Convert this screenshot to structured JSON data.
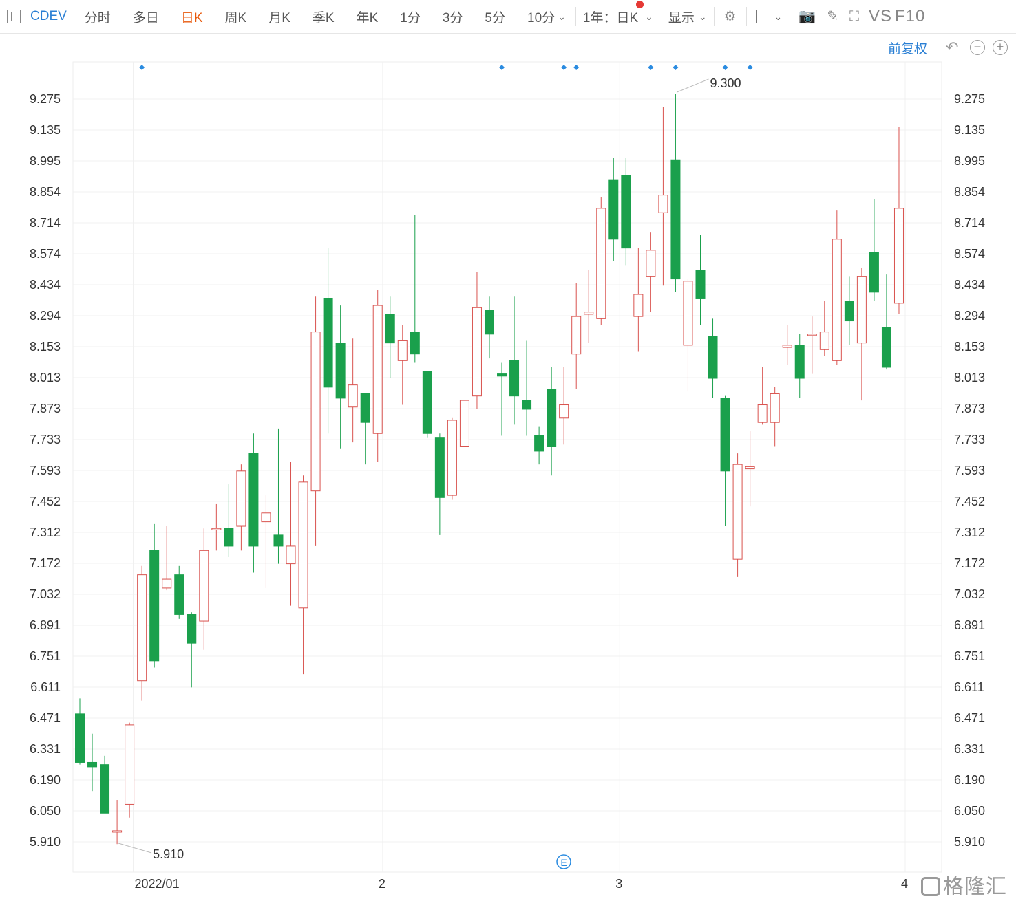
{
  "toolbar": {
    "symbol": "CDEV",
    "tabs": [
      "分时",
      "多日",
      "日K",
      "周K",
      "月K",
      "季K",
      "年K",
      "1分",
      "3分",
      "5分",
      "10分"
    ],
    "active_tab": "日K",
    "range_label": "1年：日K",
    "display_label": "显示",
    "vs_label": "VS",
    "f10_label": "F10",
    "icons": [
      "sidebar-toggle-icon",
      "chevron-down-icon",
      "gear-icon",
      "square-icon",
      "camera-icon",
      "pencil-icon",
      "fullscreen-icon",
      "panel-icon"
    ]
  },
  "subheader": {
    "adjust_label": "前复权",
    "controls": [
      "undo-icon",
      "zoom-out-icon",
      "zoom-in-icon"
    ]
  },
  "watermark": "格隆汇",
  "event_badge": "E",
  "chart_data": {
    "type": "candlestick",
    "title": "",
    "ylim": [
      5.91,
      9.275
    ],
    "y_ticks": [
      "9.275",
      "9.135",
      "8.995",
      "8.854",
      "8.714",
      "8.574",
      "8.434",
      "8.294",
      "8.153",
      "8.013",
      "7.873",
      "7.733",
      "7.593",
      "7.452",
      "7.312",
      "7.172",
      "7.032",
      "6.891",
      "6.751",
      "6.611",
      "6.471",
      "6.331",
      "6.190",
      "6.050",
      "5.910"
    ],
    "x_labels": [
      {
        "label": "2022/01",
        "index": 4.3
      },
      {
        "label": "2",
        "index": 24.4
      },
      {
        "label": "3",
        "index": 43.5
      },
      {
        "label": "4",
        "index": 66.5
      }
    ],
    "max_annotation": {
      "value": "9.300",
      "index": 48
    },
    "min_annotation": {
      "value": "5.910",
      "index": 3
    },
    "up_color": "#d9534f",
    "down_color": "#1aa04c",
    "marker_color": "#2a8be0",
    "event_markers": [
      5,
      34,
      39,
      40,
      46,
      48,
      52,
      54
    ],
    "candles": [
      [
        6.49,
        6.27,
        6.56,
        6.26
      ],
      [
        6.27,
        6.25,
        6.4,
        6.14
      ],
      [
        6.26,
        6.04,
        6.3,
        6.04
      ],
      [
        5.96,
        5.96,
        6.1,
        5.9
      ],
      [
        6.08,
        6.44,
        6.45,
        6.02
      ],
      [
        6.64,
        7.12,
        7.16,
        6.55
      ],
      [
        7.23,
        6.73,
        7.35,
        6.7
      ],
      [
        7.06,
        7.1,
        7.34,
        7.05
      ],
      [
        7.12,
        6.94,
        7.16,
        6.92
      ],
      [
        6.94,
        6.81,
        6.95,
        6.61
      ],
      [
        6.91,
        7.23,
        7.33,
        6.78
      ],
      [
        7.33,
        7.33,
        7.44,
        7.23
      ],
      [
        7.33,
        7.25,
        7.53,
        7.2
      ],
      [
        7.34,
        7.59,
        7.62,
        7.23
      ],
      [
        7.67,
        7.25,
        7.76,
        7.13
      ],
      [
        7.36,
        7.4,
        7.48,
        7.06
      ],
      [
        7.3,
        7.25,
        7.78,
        7.17
      ],
      [
        7.17,
        7.25,
        7.63,
        6.98
      ],
      [
        6.97,
        7.54,
        7.57,
        6.67
      ],
      [
        7.5,
        8.22,
        8.38,
        7.25
      ],
      [
        8.37,
        7.97,
        8.6,
        7.76
      ],
      [
        8.17,
        7.92,
        8.34,
        7.69
      ],
      [
        7.88,
        7.98,
        8.19,
        7.72
      ],
      [
        7.94,
        7.81,
        7.94,
        7.62
      ],
      [
        7.76,
        8.34,
        8.41,
        7.63
      ],
      [
        8.3,
        8.17,
        8.38,
        8.01
      ],
      [
        8.09,
        8.18,
        8.25,
        7.89
      ],
      [
        8.22,
        8.12,
        8.75,
        8.08
      ],
      [
        8.04,
        7.76,
        8.04,
        7.74
      ],
      [
        7.74,
        7.47,
        7.76,
        7.3
      ],
      [
        7.48,
        7.82,
        7.83,
        7.46
      ],
      [
        7.7,
        7.91,
        7.9,
        7.7
      ],
      [
        7.93,
        8.33,
        8.49,
        7.87
      ],
      [
        8.32,
        8.21,
        8.38,
        8.1
      ],
      [
        8.03,
        8.02,
        8.08,
        7.75
      ],
      [
        8.09,
        7.93,
        8.38,
        7.8
      ],
      [
        7.91,
        7.87,
        8.18,
        7.75
      ],
      [
        7.75,
        7.68,
        7.79,
        7.62
      ],
      [
        7.96,
        7.7,
        8.06,
        7.57
      ],
      [
        7.83,
        7.89,
        8.06,
        7.71
      ],
      [
        8.12,
        8.29,
        8.44,
        7.96
      ],
      [
        8.3,
        8.31,
        8.5,
        8.17
      ],
      [
        8.28,
        8.78,
        8.83,
        8.25
      ],
      [
        8.91,
        8.64,
        9.01,
        8.54
      ],
      [
        8.93,
        8.6,
        9.01,
        8.52
      ],
      [
        8.29,
        8.39,
        8.6,
        8.13
      ],
      [
        8.47,
        8.59,
        8.67,
        8.31
      ],
      [
        8.76,
        8.84,
        9.24,
        8.43
      ],
      [
        9.0,
        8.46,
        9.3,
        8.4
      ],
      [
        8.16,
        8.45,
        8.46,
        7.95
      ],
      [
        8.5,
        8.37,
        8.66,
        8.25
      ],
      [
        8.2,
        8.01,
        8.28,
        7.92
      ],
      [
        7.92,
        7.59,
        7.93,
        7.34
      ],
      [
        7.19,
        7.62,
        7.67,
        7.11
      ],
      [
        7.6,
        7.61,
        7.77,
        7.43
      ],
      [
        7.81,
        7.89,
        8.06,
        7.8
      ],
      [
        7.81,
        7.94,
        7.97,
        7.7
      ],
      [
        8.15,
        8.16,
        8.25,
        8.07
      ],
      [
        8.16,
        8.01,
        8.21,
        7.92
      ],
      [
        8.21,
        8.21,
        8.29,
        8.03
      ],
      [
        8.14,
        8.22,
        8.36,
        8.11
      ],
      [
        8.09,
        8.64,
        8.77,
        8.07
      ],
      [
        8.36,
        8.27,
        8.47,
        8.16
      ],
      [
        8.17,
        8.47,
        8.51,
        7.91
      ],
      [
        8.58,
        8.4,
        8.82,
        8.36
      ],
      [
        8.24,
        8.06,
        8.48,
        8.05
      ],
      [
        8.35,
        8.78,
        9.15,
        8.3
      ]
    ]
  }
}
